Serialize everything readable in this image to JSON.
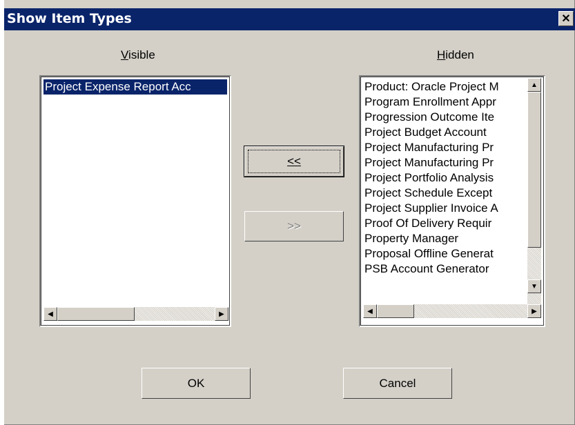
{
  "window": {
    "title": "Show Item Types",
    "close_glyph": "✕"
  },
  "visible": {
    "label": "Visible",
    "items": [
      "Project Expense Report Acc"
    ],
    "selected_index": 0
  },
  "hidden": {
    "label": "Hidden",
    "items": [
      "Product: Oracle Project M",
      "Program Enrollment Appr",
      "Progression Outcome Ite",
      "Project Budget Account",
      "Project Manufacturing Pr",
      "Project Manufacturing Pr",
      "Project Portfolio Analysis",
      "Project Schedule Except",
      "Project Supplier Invoice A",
      "Proof Of Delivery Requir",
      "Property Manager",
      "Proposal Offline Generat",
      "PSB Account Generator"
    ]
  },
  "buttons": {
    "add_label": "<<",
    "remove_label": ">>",
    "ok_label": "OK",
    "cancel_label": "Cancel"
  },
  "icons": {
    "close": "close-icon",
    "scroll_left": "scroll-left-icon",
    "scroll_right": "scroll-right-icon",
    "scroll_up": "scroll-up-icon",
    "scroll_down": "scroll-down-icon"
  },
  "colors": {
    "titlebar": "#0a246a",
    "face": "#d4d0c8",
    "selection": "#0a246a"
  }
}
